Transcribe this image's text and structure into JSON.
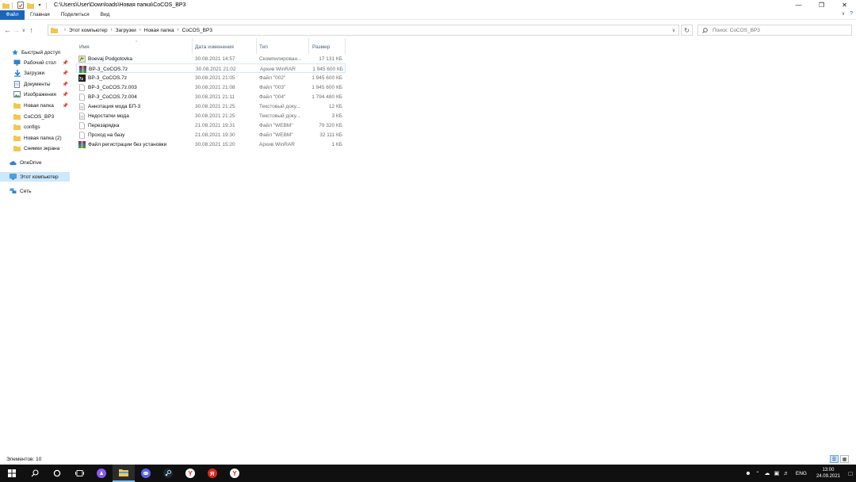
{
  "window": {
    "title_path": "C:\\Users\\User\\Downloads\\Новая папка\\CoCOS_BP3"
  },
  "ribbon": {
    "tabs": [
      {
        "label": "Файл",
        "active": true
      },
      {
        "label": "Главная",
        "active": false
      },
      {
        "label": "Поделиться",
        "active": false
      },
      {
        "label": "Вид",
        "active": false
      }
    ]
  },
  "address": {
    "breadcrumbs": [
      "Этот компьютер",
      "Загрузки",
      "Новая папка",
      "CoCOS_BP3"
    ],
    "search_placeholder": "Поиск: CoCOS_BP3"
  },
  "navpane": {
    "items": [
      {
        "label": "Быстрый доступ",
        "icon": "star-icon",
        "pinned": false,
        "indent": 0
      },
      {
        "label": "Рабочий стол",
        "icon": "desktop-icon",
        "pinned": true,
        "indent": 1
      },
      {
        "label": "Загрузки",
        "icon": "download-icon",
        "pinned": true,
        "indent": 1
      },
      {
        "label": "Документы",
        "icon": "documents-icon",
        "pinned": true,
        "indent": 1
      },
      {
        "label": "Изображения",
        "icon": "pictures-icon",
        "pinned": true,
        "indent": 1
      },
      {
        "label": "Новая папка",
        "icon": "folder-icon",
        "pinned": true,
        "indent": 1
      },
      {
        "label": "CoCOS_BP3",
        "icon": "folder-icon",
        "pinned": false,
        "indent": 1
      },
      {
        "label": "configs",
        "icon": "folder-icon",
        "pinned": false,
        "indent": 1
      },
      {
        "label": "Новая папка (2)",
        "icon": "folder-icon",
        "pinned": false,
        "indent": 1
      },
      {
        "label": "Снимки экрана",
        "icon": "folder-icon",
        "pinned": false,
        "indent": 1
      },
      {
        "label": "OneDrive",
        "icon": "cloud-icon",
        "pinned": false,
        "indent": 0
      },
      {
        "label": "Этот компьютер",
        "icon": "computer-icon",
        "pinned": false,
        "indent": 0,
        "selected": true
      },
      {
        "label": "Сеть",
        "icon": "network-icon",
        "pinned": false,
        "indent": 0
      }
    ]
  },
  "filelist": {
    "columns": {
      "name": "Имя",
      "date": "Дата изменения",
      "type": "Тип",
      "size": "Размер"
    },
    "files": [
      {
        "name": "Boevaj Podgotovka",
        "date": "30.08.2021 14:57",
        "type": "Скомпилирован...",
        "size": "17 131 КБ",
        "icon": "compiled-file-icon"
      },
      {
        "name": "BP-3_CoCOS.7z",
        "date": "30.08.2021 21:02",
        "type": "Архив WinRAR",
        "size": "1 945 600 КБ",
        "icon": "winrar-archive-icon",
        "hover": true
      },
      {
        "name": "BP-3_CoCOS.7z",
        "date": "30.08.2021 21:05",
        "type": "Файл \"002\"",
        "size": "1 945 600 КБ",
        "icon": "7z-file-icon"
      },
      {
        "name": "BP-3_CoCOS.7z.003",
        "date": "30.08.2021 21:08",
        "type": "Файл \"003\"",
        "size": "1 945 600 КБ",
        "icon": "blank-file-icon"
      },
      {
        "name": "BP-3_CoCOS.7z.004",
        "date": "30.08.2021 21:11",
        "type": "Файл \"004\"",
        "size": "1 794 480 КБ",
        "icon": "blank-file-icon"
      },
      {
        "name": "Аннотация мода БП-3",
        "date": "30.08.2021 21:25",
        "type": "Текстовый доку...",
        "size": "12 КБ",
        "icon": "text-file-icon"
      },
      {
        "name": "Недостатки мода",
        "date": "30.08.2021 21:25",
        "type": "Текстовый доку...",
        "size": "3 КБ",
        "icon": "text-file-icon"
      },
      {
        "name": "Перезарядка",
        "date": "21.08.2021 19:31",
        "type": "Файл \"WEBM\"",
        "size": "79 320 КБ",
        "icon": "blank-file-icon"
      },
      {
        "name": "Проход на базу",
        "date": "21.08.2021 19:30",
        "type": "Файл \"WEBM\"",
        "size": "32 111 КБ",
        "icon": "blank-file-icon"
      },
      {
        "name": "Файл регистрации без установки",
        "date": "30.08.2021 15:20",
        "type": "Архив WinRAR",
        "size": "1 КБ",
        "icon": "winrar-archive-icon"
      }
    ]
  },
  "status": {
    "items_count": "Элементов: 10"
  },
  "taskbar": {
    "apps": [
      "start-icon",
      "search-icon",
      "cortana-icon",
      "taskview-icon",
      "alice-icon",
      "file-explorer-icon",
      "discord-icon",
      "steam-icon",
      "yandex-browser-icon",
      "yandex-icon",
      "winrar-icon"
    ],
    "active_app": "file-explorer-icon",
    "language": "ENG",
    "time": "13:00",
    "date": "24.09.2021"
  },
  "colors": {
    "accent": "#1a66b8",
    "selection": "#cce8ff",
    "taskbar": "#101010"
  }
}
